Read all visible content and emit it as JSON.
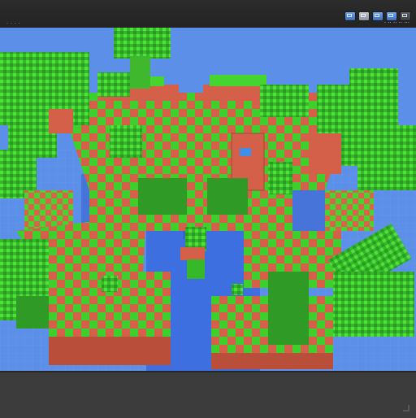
{
  "window": {
    "top_left_text": "· · · ·",
    "top_right_text": "· ·· ·· ·· ···"
  },
  "toolbar": {
    "icons": [
      "view-icon",
      "layers-icon",
      "render-icon",
      "camera-icon",
      "settings-icon"
    ]
  },
  "scene": {
    "sky_color": "#5b8fe8",
    "grass_color": "#3fcf2c",
    "brick_color": "#d4604a",
    "water_color": "#3d6fe0"
  }
}
